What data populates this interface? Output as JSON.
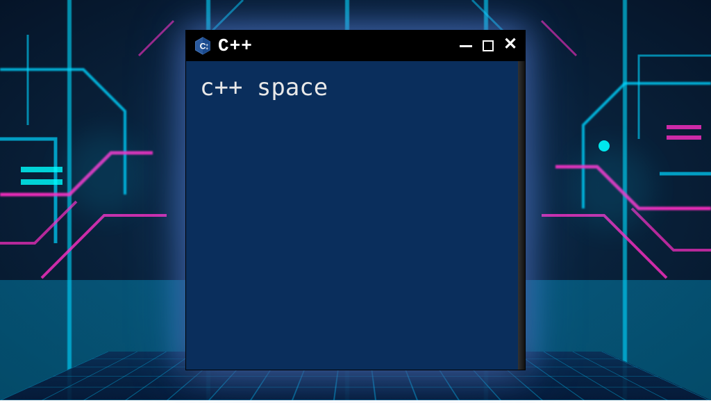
{
  "window": {
    "title": "C++",
    "content_text": "c++ space"
  },
  "colors": {
    "terminal_bg": "#0a2e5c",
    "titlebar_bg": "#000000",
    "text": "#e8e8e8"
  }
}
